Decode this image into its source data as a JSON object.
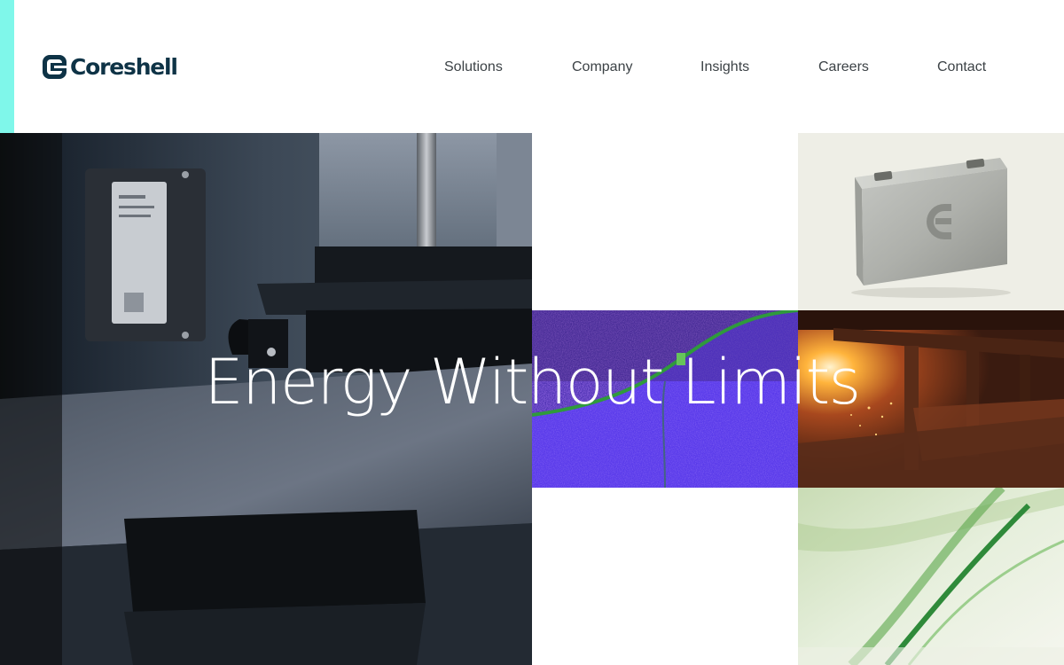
{
  "brand": {
    "name": "Coreshell",
    "accent_color": "#7ff7ea",
    "primary_color": "#0e3346"
  },
  "nav": {
    "items": [
      {
        "label": "Solutions"
      },
      {
        "label": "Company"
      },
      {
        "label": "Insights"
      },
      {
        "label": "Careers"
      },
      {
        "label": "Contact"
      }
    ]
  },
  "hero": {
    "title": "Energy Without Limits"
  },
  "tiles": [
    {
      "name": "factory-machine-photo",
      "icon": "machinery-image"
    },
    {
      "name": "battery-cell-photo",
      "icon": "battery-cell-image"
    },
    {
      "name": "microscopy-image",
      "icon": "microscopy-image"
    },
    {
      "name": "steel-mill-photo",
      "icon": "steel-mill-image"
    },
    {
      "name": "green-fiber-photo",
      "icon": "abstract-green-image"
    }
  ]
}
